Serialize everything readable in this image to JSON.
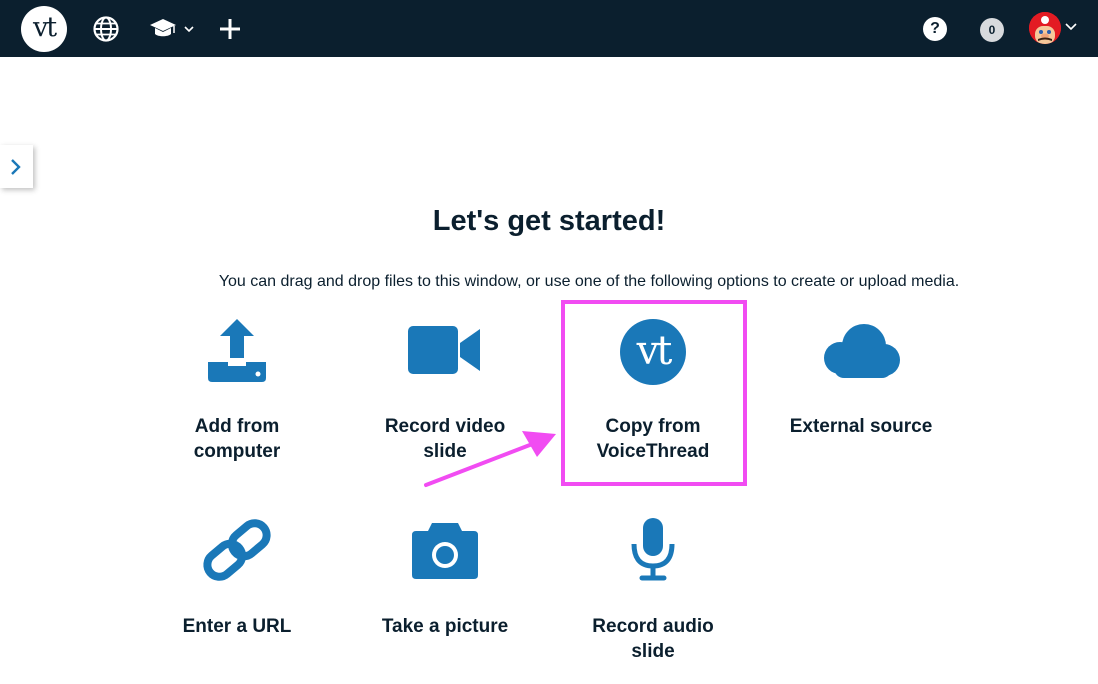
{
  "topbar": {
    "logo_text": "vt",
    "globe_icon": "globe-icon",
    "courses_icon": "graduation-cap-icon",
    "create_icon": "plus-icon",
    "help_text": "?",
    "notification_count": "0",
    "avatar_icon": "user-avatar"
  },
  "sidebar_toggle": {
    "icon": "chevron-right-icon"
  },
  "main": {
    "title": "Let's get started!",
    "subtitle": "You can drag and drop files to this window, or use one of the following options to create or upload media."
  },
  "options": [
    {
      "line1": "Add from",
      "line2": "computer",
      "icon": "upload-icon"
    },
    {
      "line1": "Record video",
      "line2": "slide",
      "icon": "video-camera-icon"
    },
    {
      "line1": "Copy from",
      "line2": "VoiceThread",
      "icon": "voicethread-logo-icon",
      "icon_text": "vt"
    },
    {
      "line1": "External source",
      "line2": "",
      "icon": "cloud-icon"
    },
    {
      "line1": "Enter a URL",
      "line2": "",
      "icon": "link-icon"
    },
    {
      "line1": "Take a picture",
      "line2": "",
      "icon": "camera-icon"
    },
    {
      "line1": "Record audio",
      "line2": "slide",
      "icon": "microphone-icon"
    }
  ],
  "annotation": {
    "highlight_color": "#f14cf2",
    "arrow_color": "#f14cf2"
  },
  "colors": {
    "topbar_bg": "#0b1f2e",
    "icon_blue": "#1a78b8",
    "text_dark": "#0b1f2e"
  }
}
